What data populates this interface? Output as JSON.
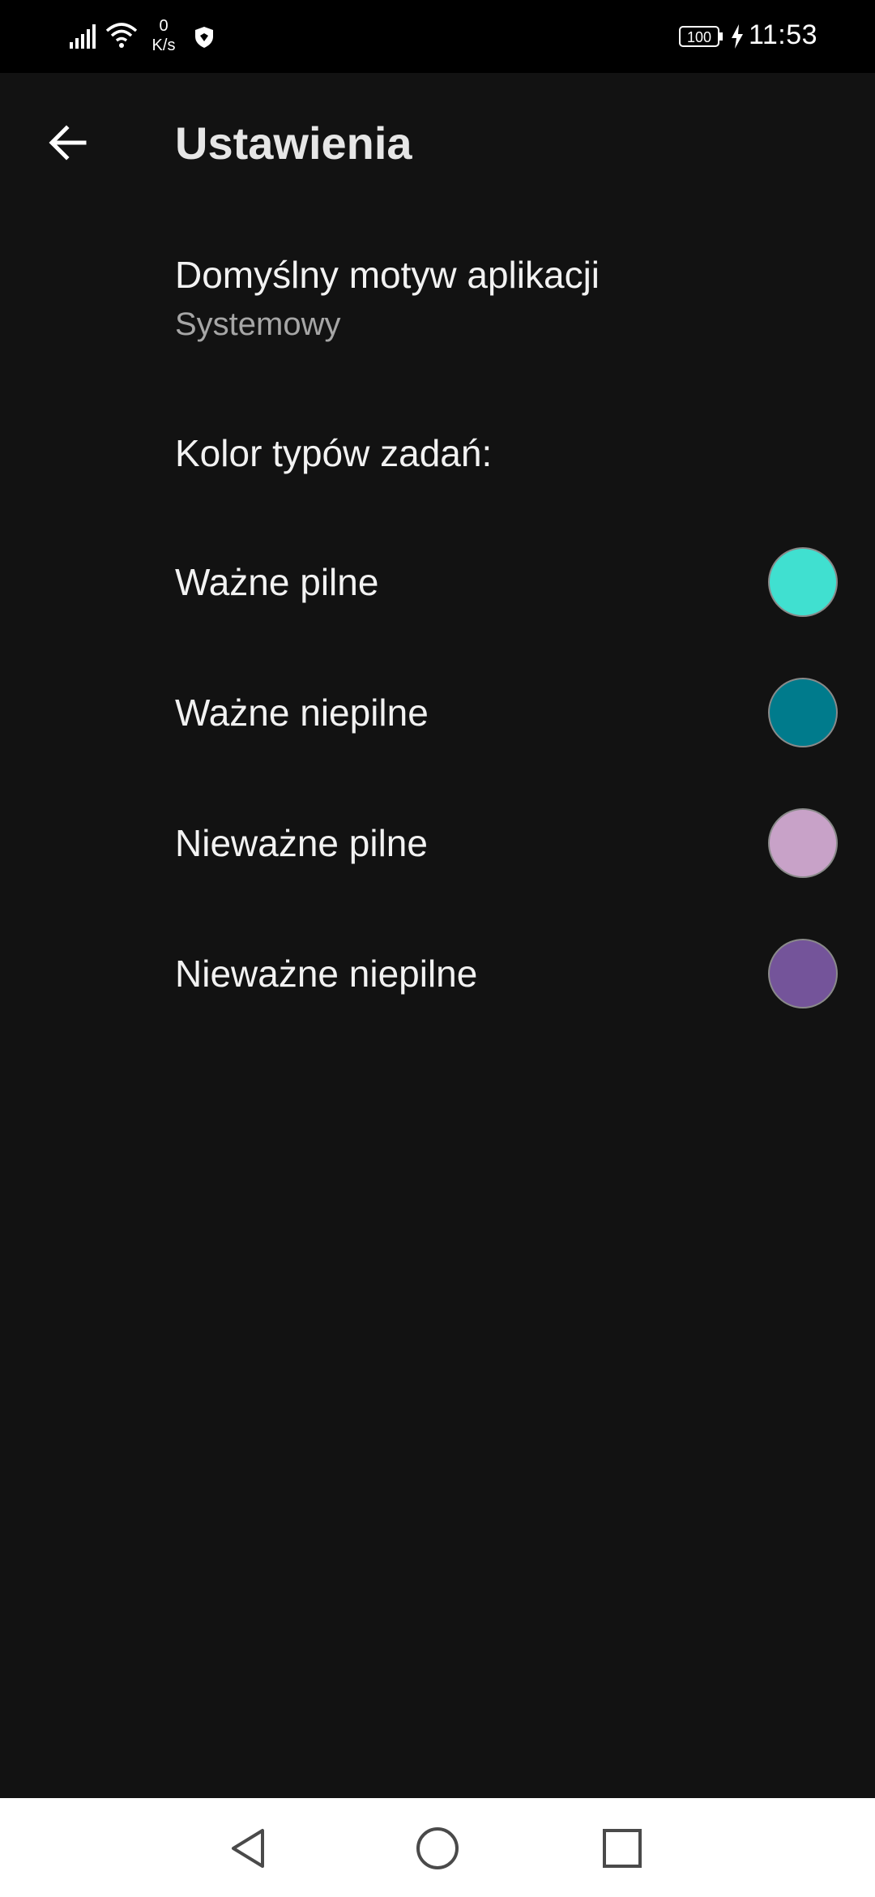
{
  "status_bar": {
    "net_speed_value": "0",
    "net_speed_unit": "K/s",
    "battery": "100",
    "time": "11:53",
    "icons": [
      "signal-icon",
      "wifi-icon",
      "shield-icon",
      "battery-icon",
      "charging-icon"
    ]
  },
  "app_bar": {
    "back_icon": "arrow-back-icon",
    "title": "Ustawienia"
  },
  "theme_pref": {
    "title": "Domyślny motyw aplikacji",
    "summary": "Systemowy"
  },
  "colors_section": {
    "label": "Kolor typów zadań:",
    "items": [
      {
        "label": "Ważne pilne",
        "color": "#40E0D0"
      },
      {
        "label": "Ważne niepilne",
        "color": "#007B8C"
      },
      {
        "label": "Nieważne pilne",
        "color": "#C8A2C8"
      },
      {
        "label": "Nieważne niepilne",
        "color": "#74549A"
      }
    ]
  },
  "nav_bar": {
    "icons": [
      "nav-back-icon",
      "nav-home-icon",
      "nav-recents-icon"
    ]
  },
  "colors": {
    "background": "#121212",
    "status_bar": "#000000",
    "nav_bar": "#FFFFFF",
    "primary_text": "#F2F2F2",
    "secondary_text": "#A6A6A6"
  }
}
